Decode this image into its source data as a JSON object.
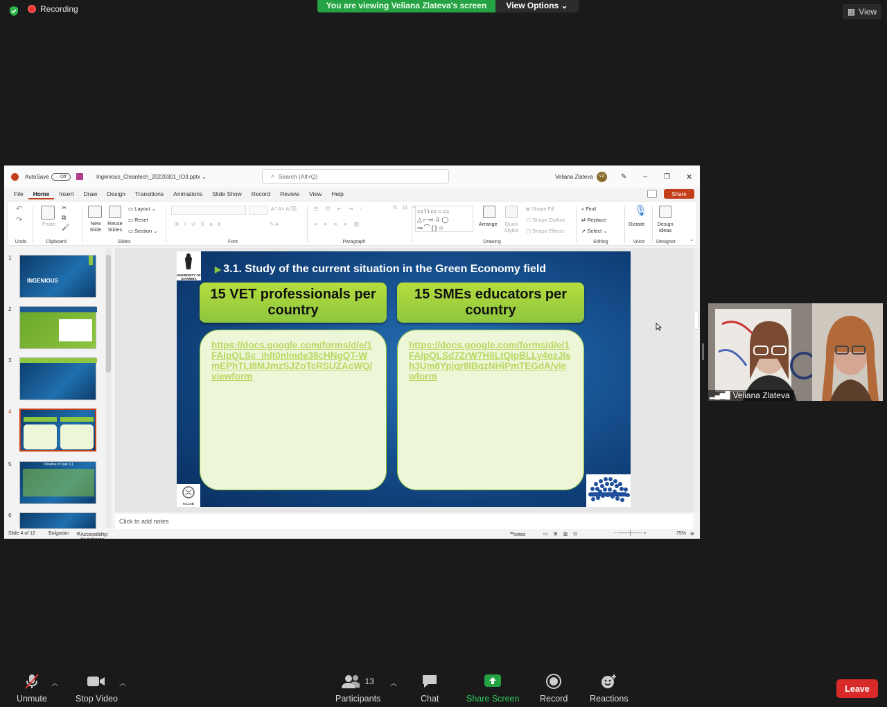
{
  "zoom": {
    "recording_label": "Recording",
    "viewing_banner": "You are viewing Veliana Zlateva's screen",
    "view_options": "View Options",
    "view_button": "View",
    "participant_name": "Veliana Zlateva",
    "bottom_bar": {
      "unmute": "Unmute",
      "stop_video": "Stop Video",
      "participants": "Participants",
      "participants_count": "13",
      "chat": "Chat",
      "share_screen": "Share Screen",
      "record": "Record",
      "reactions": "Reactions",
      "leave": "Leave"
    }
  },
  "ppt": {
    "autosave": "AutoSave",
    "autosave_state": "Off",
    "filename": "Ingenious_Cleantech_20220301_IO3.pptx",
    "search_placeholder": "Search (Alt+Q)",
    "user_name": "Veliana Zlateva",
    "user_initials": "VZ",
    "menus": [
      "File",
      "Home",
      "Insert",
      "Draw",
      "Design",
      "Transitions",
      "Animations",
      "Slide Show",
      "Record",
      "Review",
      "View",
      "Help"
    ],
    "share": "Share",
    "ribbon": {
      "undo_group": "Undo",
      "clipboard_group": "Clipboard",
      "paste": "Paste",
      "slides_group": "Slides",
      "new_slide": "New Slide",
      "reuse_slides": "Reuse Slides",
      "layout": "Layout",
      "reset": "Reset",
      "section": "Section",
      "font_group": "Font",
      "paragraph_group": "Paragraph",
      "drawing_group": "Drawing",
      "arrange": "Arrange",
      "quick_styles": "Quick Styles",
      "shape_fill": "Shape Fill",
      "shape_outline": "Shape Outline",
      "shape_effects": "Shape Effects",
      "editing_group": "Editing",
      "find": "Find",
      "replace": "Replace",
      "select": "Select",
      "voice_group": "Voice",
      "dictate": "Dictate",
      "designer_group": "Designer",
      "design_ideas": "Design Ideas"
    },
    "thumbnails": [
      {
        "num": "1",
        "text": "INGENIOUS"
      },
      {
        "num": "2",
        "text": ""
      },
      {
        "num": "3",
        "text": ""
      },
      {
        "num": "4",
        "text": ""
      },
      {
        "num": "5",
        "text": "Timeline of task 3.1"
      },
      {
        "num": "6",
        "text": ""
      }
    ],
    "slide": {
      "title": "3.1. Study of the current situation in the Green Economy field",
      "box1_title": "15 VET professionals per country",
      "box2_title": "15 SMEs educators per country",
      "box1_link": "https://docs.google.com/forms/d/e/1FAIpQLSc_ihlt0nlmde38cHNgQT-WmEPhTLI8MJmzSJZoTcRSUZAcWQ/viewform",
      "box2_link": "https://docs.google.com/forms/d/e/1FAIpQLSd7ZrW7H6LtQipBLLy4ozJIsh3Um8Ypjqr8IBqzNHiPmTEGdA/viewform",
      "uni_logo_text": "UNIVERSITY OF IOANNINA",
      "kc_logo_text": "KCLAB"
    },
    "notes_placeholder": "Click to add notes",
    "status": {
      "slide_of": "Slide 4 of 12",
      "language": "Bulgarian",
      "accessibility": "Accessibility: Investigate",
      "notes": "Notes",
      "zoom": "75%"
    }
  }
}
